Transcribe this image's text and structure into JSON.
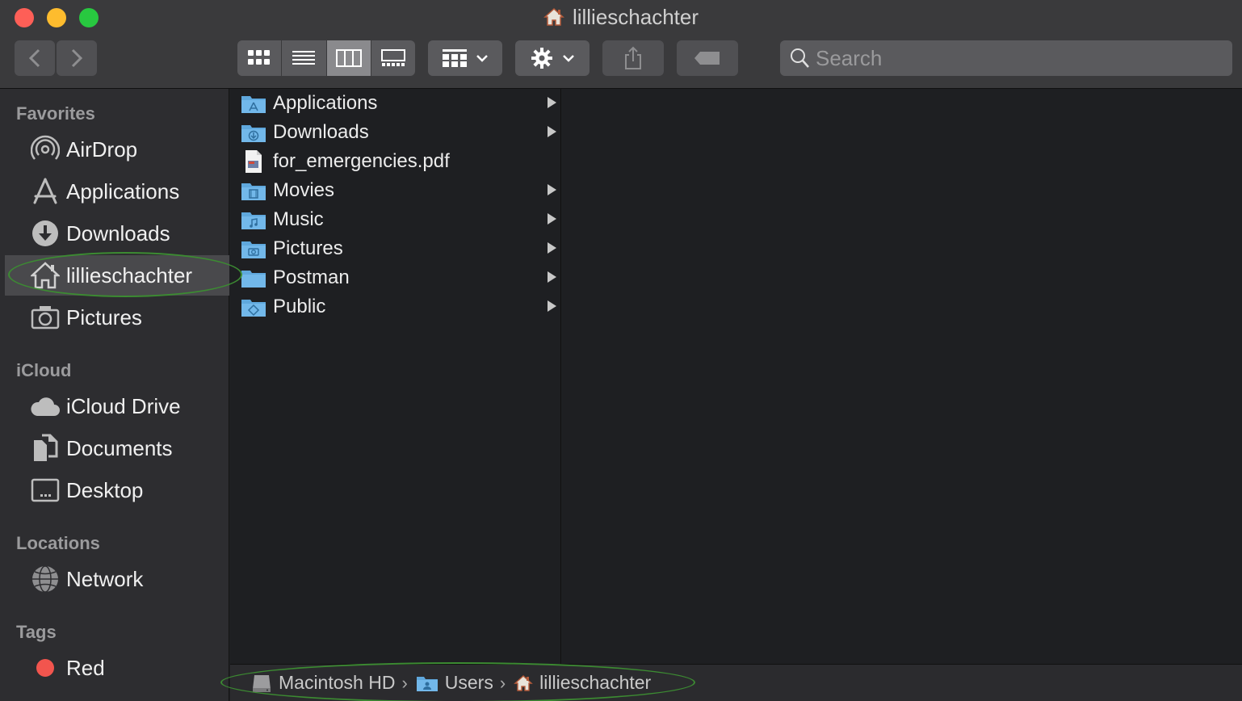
{
  "window": {
    "title": "lillieschachter"
  },
  "toolbar": {
    "back_icon": "chevron-left-icon",
    "forward_icon": "chevron-right-icon",
    "view_modes": [
      "icon-view",
      "list-view",
      "column-view",
      "gallery-view"
    ],
    "active_view": "column-view",
    "search_placeholder": "Search"
  },
  "sidebar": {
    "favorites_label": "Favorites",
    "favorites": [
      {
        "label": "AirDrop",
        "icon": "airdrop-icon"
      },
      {
        "label": "Applications",
        "icon": "applications-icon"
      },
      {
        "label": "Downloads",
        "icon": "downloads-icon"
      },
      {
        "label": "lillieschachter",
        "icon": "home-icon",
        "selected": true
      },
      {
        "label": "Pictures",
        "icon": "camera-icon"
      }
    ],
    "icloud_label": "iCloud",
    "icloud": [
      {
        "label": "iCloud Drive",
        "icon": "cloud-icon"
      },
      {
        "label": "Documents",
        "icon": "documents-icon"
      },
      {
        "label": "Desktop",
        "icon": "desktop-icon"
      }
    ],
    "locations_label": "Locations",
    "locations": [
      {
        "label": "Network",
        "icon": "network-icon"
      }
    ],
    "tags_label": "Tags",
    "tags": [
      {
        "label": "Red",
        "color": "#f2554e"
      }
    ]
  },
  "column": {
    "items": [
      {
        "name": "Applications",
        "icon": "folder-applications-icon",
        "has_children": true
      },
      {
        "name": "Downloads",
        "icon": "folder-downloads-icon",
        "has_children": true
      },
      {
        "name": "for_emergencies.pdf",
        "icon": "pdf-file-icon",
        "has_children": false
      },
      {
        "name": "Movies",
        "icon": "folder-movies-icon",
        "has_children": true
      },
      {
        "name": "Music",
        "icon": "folder-music-icon",
        "has_children": true
      },
      {
        "name": "Pictures",
        "icon": "folder-pictures-icon",
        "has_children": true
      },
      {
        "name": "Postman",
        "icon": "folder-icon",
        "has_children": true
      },
      {
        "name": "Public",
        "icon": "folder-public-icon",
        "has_children": true
      }
    ]
  },
  "pathbar": {
    "crumbs": [
      {
        "label": "Macintosh HD",
        "icon": "hard-drive-icon"
      },
      {
        "label": "Users",
        "icon": "folder-users-icon"
      },
      {
        "label": "lillieschachter",
        "icon": "home-icon"
      }
    ]
  },
  "colors": {
    "folder_blue": "#5fa8dd",
    "annotation_green": "#3c8b32",
    "selected_bg": "#49494c"
  }
}
